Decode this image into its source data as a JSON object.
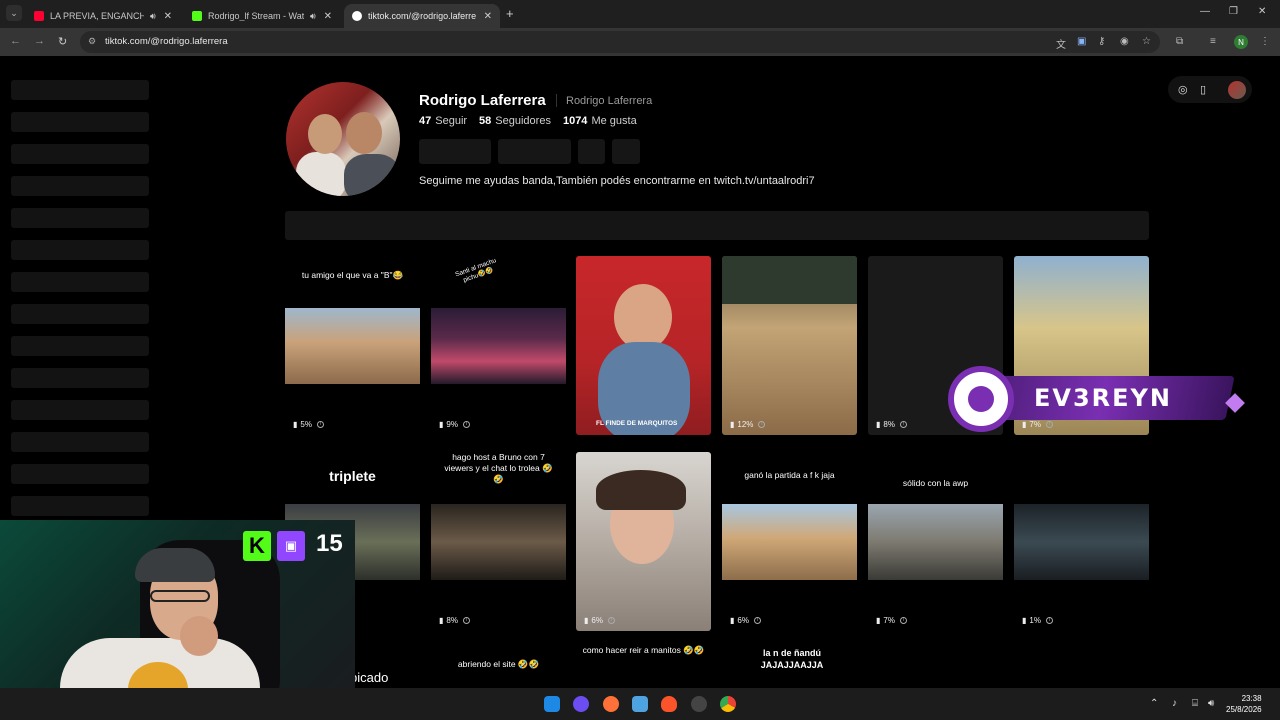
{
  "browser": {
    "tabs": [
      {
        "title": "LA PREVIA, ENGANCHADO",
        "favicon_color": "#ff0033",
        "active": false
      },
      {
        "title": "Rodrigo_lf Stream - Watch",
        "favicon_color": "#53fc18",
        "active": false
      },
      {
        "title": "tiktok.com/@rodrigo.laferrera",
        "favicon_color": "#ffffff",
        "active": true
      }
    ],
    "new_tab": "+",
    "url": "tiktok.com/@rodrigo.laferrera",
    "profile_initial": "N"
  },
  "profile": {
    "name": "Rodrigo Laferrera",
    "username": "Rodrigo Laferrera",
    "following_count": "47",
    "following_label": "Seguir",
    "followers_count": "58",
    "followers_label": "Seguidores",
    "likes_count": "1074",
    "likes_label": "Me gusta",
    "bio": "Seguime me ayudas banda,También podés encontrarme en twitch.tv/untaalrodri7"
  },
  "videos": [
    {
      "caption": "tu amigo el que va a \"B\"😂",
      "views": "5%"
    },
    {
      "caption": "Santi al machu pichu🤣🤣",
      "views": "9%"
    },
    {
      "caption": "FL FINDE DE MARQUITOS",
      "views": ""
    },
    {
      "caption": "",
      "views": "12%"
    },
    {
      "caption": "",
      "views": "8%"
    },
    {
      "caption": "",
      "views": "7%"
    },
    {
      "caption": "triplete",
      "views": ""
    },
    {
      "caption": "hago host a Bruno con 7 viewers y el chat lo trolea 🤣🤣",
      "views": "8%"
    },
    {
      "caption": "",
      "views": "6%"
    },
    {
      "caption": "ganó la partida a f k jaja",
      "views": "6%"
    },
    {
      "caption": "sólido con la awp",
      "views": "7%"
    },
    {
      "caption": "",
      "views": "1%"
    }
  ],
  "bottom_captions": {
    "c1": "picado",
    "c2": "abriendo el site 🤣🤣",
    "c3": "como hacer reir a manitos 🤣🤣",
    "c4": "la n de ñandú JAJAJJAAJJA"
  },
  "overlay": {
    "logo_text": "EV3REYN",
    "badge_k": "K",
    "badge_number": "15"
  },
  "taskbar": {
    "time": "23:38",
    "date": "25/8/2026"
  }
}
